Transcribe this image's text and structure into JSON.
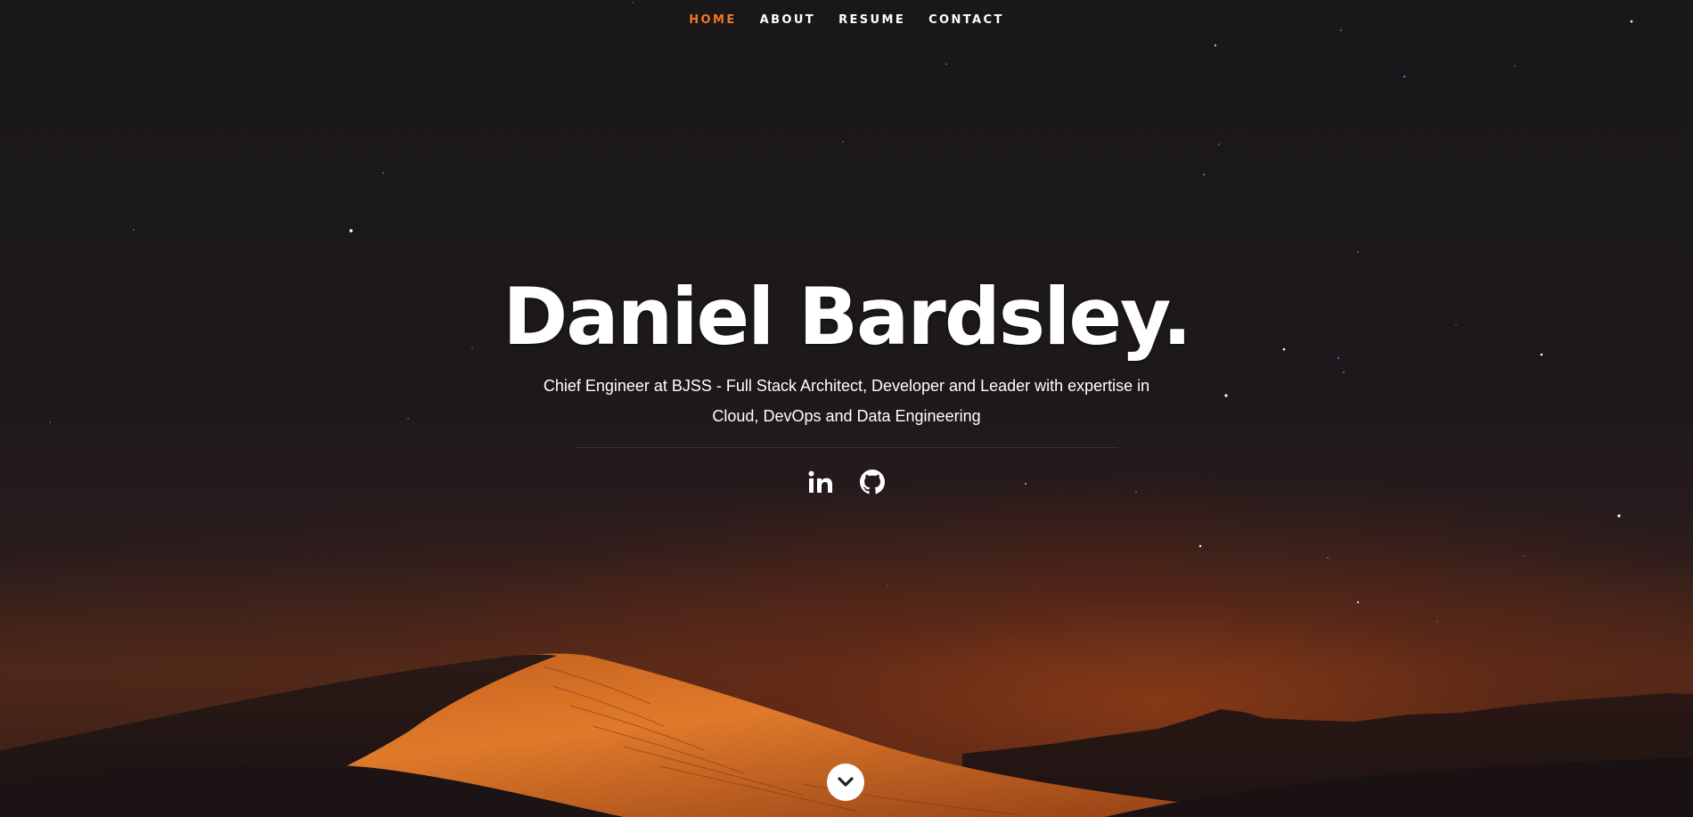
{
  "nav": {
    "items": [
      {
        "label": "Home",
        "active": true
      },
      {
        "label": "About",
        "active": false
      },
      {
        "label": "Resume",
        "active": false
      },
      {
        "label": "Contact",
        "active": false
      }
    ]
  },
  "banner": {
    "title": "Daniel Bardsley.",
    "subtitle": "Chief Engineer at BJSS - Full Stack Architect, Developer and Leader with expertise in Cloud, DevOps and Data Engineering"
  },
  "social": {
    "icons": [
      "linkedin-icon",
      "github-icon"
    ]
  },
  "scroll_down": {
    "icon": "chevron-down-icon"
  },
  "colors": {
    "accent": "#f2761f",
    "background": "#1b181a",
    "text": "#ffffff"
  }
}
